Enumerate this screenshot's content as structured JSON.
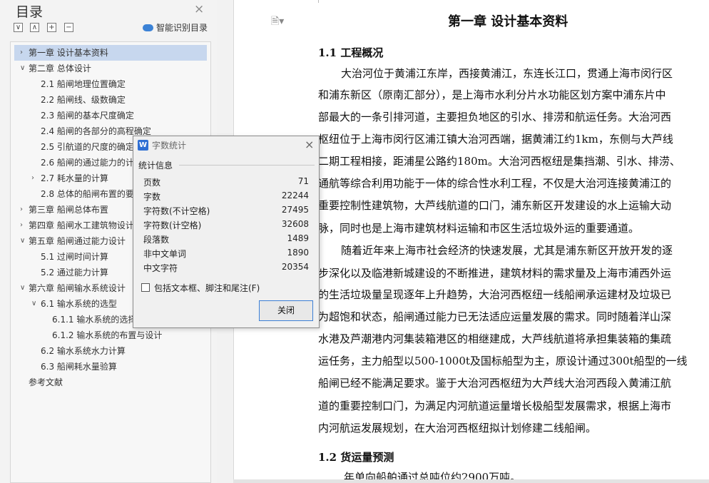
{
  "nav": {
    "title": "目录",
    "close_glyph": "×",
    "tools": [
      "∨",
      "∧",
      "+",
      "−"
    ],
    "smart_toc_label": "智能识别目录",
    "items": [
      {
        "label": "第一章  设计基本资料",
        "arrow": "›",
        "selected": true
      },
      {
        "label": "第二章  总体设计",
        "arrow": "∨"
      },
      {
        "label": "2.1  船闸地理位置确定"
      },
      {
        "label": "2.2  船闸线、级数确定"
      },
      {
        "label": "2.3  船闸的基本尺度确定"
      },
      {
        "label": "2.4  船闸的各部分的高程确定"
      },
      {
        "label": "2.5  引航道的尺度的确定"
      },
      {
        "label": "2.6  船闸的通过能力的计"
      },
      {
        "label": "2.7  耗水量的计算",
        "arrow": "›"
      },
      {
        "label": "2.8  总体的船闸布置的要"
      },
      {
        "label": "第三章  船闸总体布置",
        "arrow": "›"
      },
      {
        "label": "第四章  船闸水工建筑物设计",
        "arrow": "›"
      },
      {
        "label": "第五章  船闸通过能力设计",
        "arrow": "∨"
      },
      {
        "label": "5.1 过闸时间计算"
      },
      {
        "label": "5.2 通过能力计算"
      },
      {
        "label": "第六章  船闸输水系统设计",
        "arrow": "∨"
      },
      {
        "label": "6.1 输水系统的选型",
        "arrow": "∨"
      },
      {
        "label": "6.1.1 输水系统的选择"
      },
      {
        "label": "6.1.2 输水系统的布置与设计"
      },
      {
        "label": "6.2 输水系统水力计算"
      },
      {
        "label": "6.3 船闸耗水量验算"
      },
      {
        "label": "参考文献"
      }
    ]
  },
  "dialog": {
    "title": "字数统计",
    "icon_letter": "W",
    "close_glyph": "×",
    "group_title": "统计信息",
    "stats": [
      {
        "label": "页数",
        "value": "71"
      },
      {
        "label": "字数",
        "value": "22244"
      },
      {
        "label": "字符数(不计空格)",
        "value": "27495"
      },
      {
        "label": "字符数(计空格)",
        "value": "32608"
      },
      {
        "label": "段落数",
        "value": "1489"
      },
      {
        "label": "非中文单词",
        "value": "1890"
      },
      {
        "label": "中文字符",
        "value": "20354"
      }
    ],
    "checkbox_label": "包括文本框、脚注和尾注(F)",
    "checkbox_checked": false,
    "close_button": "关闭"
  },
  "document": {
    "chapter_title": "第一章  设计基本资料",
    "section1_title": "1.1 工程概况",
    "para1_lines": [
      "大治河位于黄浦江东岸，西接黄浦江，东连长江口，贯通上海市闵行区",
      "和浦东新区（原南汇部分），是上海市水利分片水功能区划方案中浦东片中",
      "部最大的一条引排河道，主要担负地区的引水、排涝和航运任务。大治河西",
      "枢纽位于上海市闵行区浦江镇大治河西端，据黄浦江约1km，东侧与大芦线",
      "二期工程相接，距浦星公路约180m。大治河西枢纽是集挡潮、引水、排涝、",
      "通航等综合利用功能于一体的综合性水利工程，不仅是大治河连接黄浦江的",
      "重要控制性建筑物，大芦线航道的口门，浦东新区开发建设的水上运输大动",
      "脉，同时也是上海市建筑材料运输和市区生活垃圾外运的重要通道。"
    ],
    "para2_lines": [
      "随着近年来上海市社会经济的快速发展，尤其是浦东新区开放开发的逐",
      "步深化以及临港新城建设的不断推进，建筑材料的需求量及上海市浦西外运",
      "的生活垃圾量呈现逐年上升趋势，大治河西枢纽一线船闸承运建材及垃圾已",
      "为超饱和状态，船闸通过能力已无法适应运量发展的需求。同时随着洋山深",
      "水港及芦潮港内河集装箱港区的相继建成，大芦线航道将承担集装箱的集疏",
      "运任务，主力船型以500-1000t及国标船型为主，原设计通过300t船型的一线",
      "船闸已经不能满足要求。鉴于大治河西枢纽为大芦线大治河西段入黄浦江航",
      "道的重要控制口门，为满足内河航道运量增长极船型发展需求，根据上海市",
      "内河航运发展规划，在大治河西枢纽拟计划修建二线船闸。"
    ],
    "section2_title": "1.2  货运量预测",
    "para3_line": "年单向船舶通过总吨位约2900万吨。"
  }
}
